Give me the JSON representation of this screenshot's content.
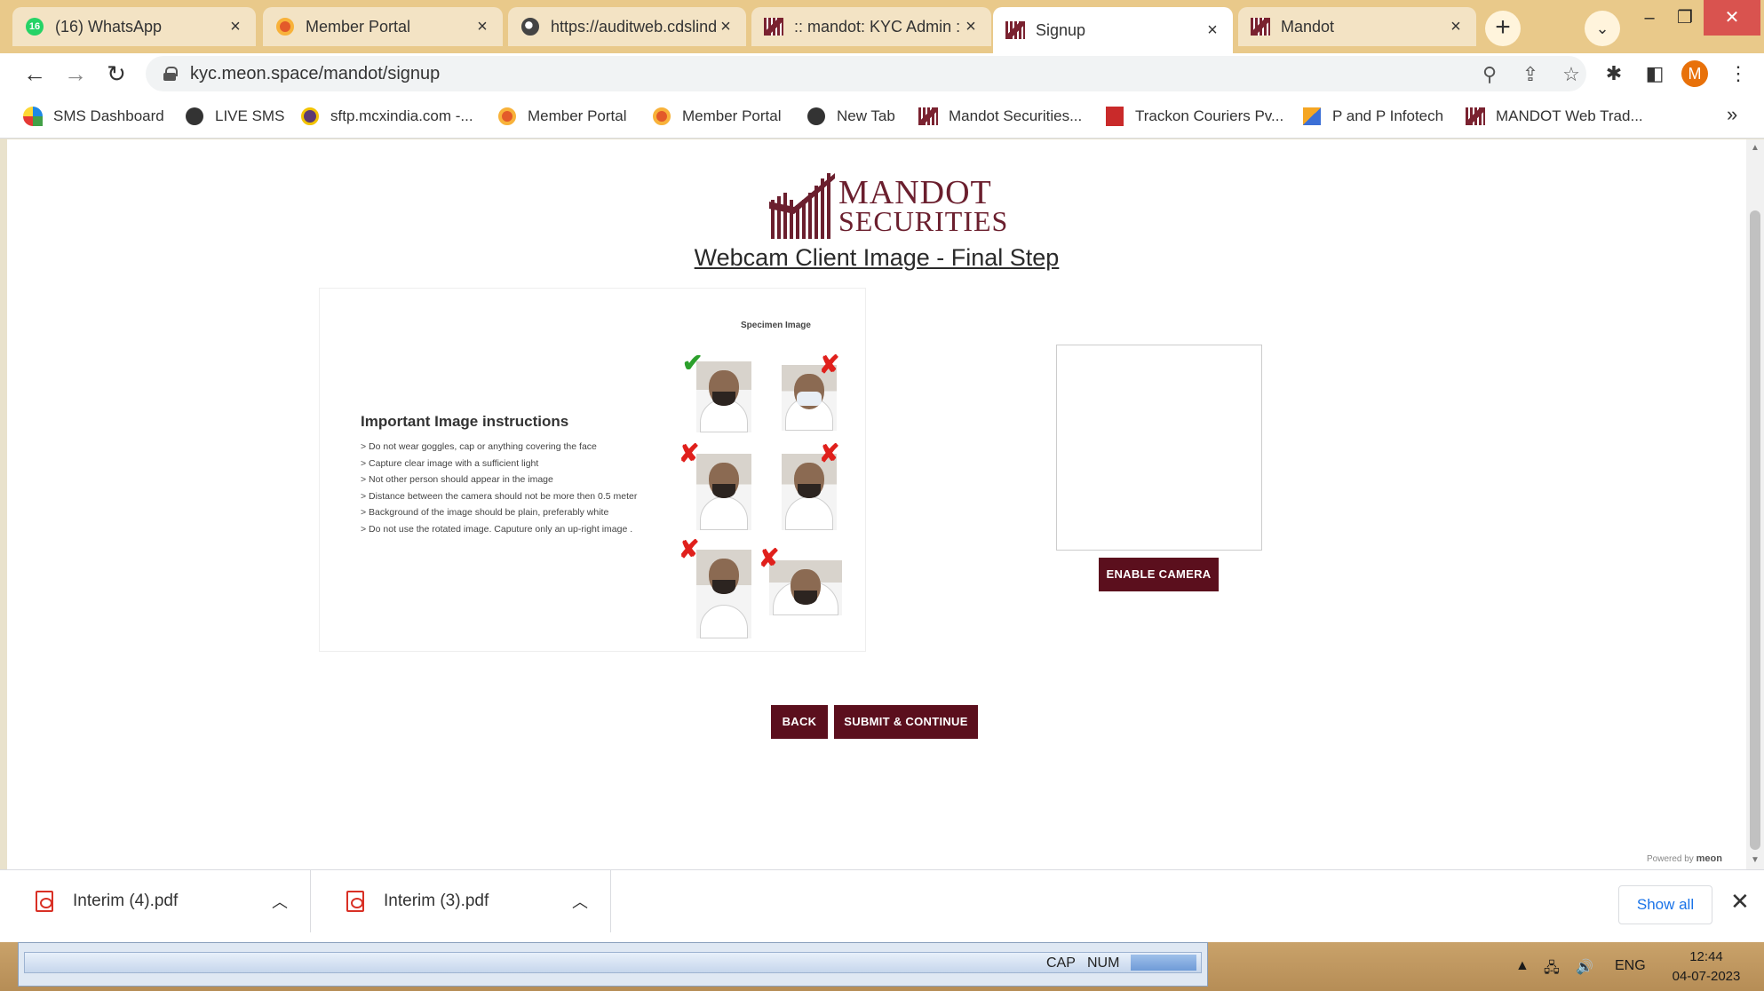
{
  "browser": {
    "tabs": [
      {
        "title": "(16) WhatsApp",
        "badge": "16",
        "icon": "whatsapp-icon",
        "active": false
      },
      {
        "title": "Member Portal",
        "icon": "member-portal-icon",
        "active": false
      },
      {
        "title": "https://auditweb.cdslindia.com",
        "icon": "globe-icon",
        "active": false
      },
      {
        "title": ":: mandot: KYC Admin ::",
        "icon": "mandot-logo-icon",
        "active": false
      },
      {
        "title": "Signup",
        "icon": "mandot-logo-icon",
        "active": true
      },
      {
        "title": "Mandot",
        "icon": "mandot-logo-icon",
        "active": false
      }
    ],
    "new_tab_label": "+",
    "url": "kyc.meon.space/mandot/signup",
    "profile_initial": "M",
    "bookmarks": [
      {
        "label": "SMS Dashboard",
        "icon": "sms-dashboard-icon"
      },
      {
        "label": "LIVE SMS",
        "icon": "globe-icon"
      },
      {
        "label": "sftp.mcxindia.com -...",
        "icon": "mcx-icon"
      },
      {
        "label": "Member Portal",
        "icon": "member-portal-icon"
      },
      {
        "label": "Member Portal",
        "icon": "member-portal-icon"
      },
      {
        "label": "New Tab",
        "icon": "globe-icon"
      },
      {
        "label": "Mandot Securities...",
        "icon": "mandot-logo-icon"
      },
      {
        "label": "Trackon Couriers Pv...",
        "icon": "trackon-icon"
      },
      {
        "label": "P and P Infotech",
        "icon": "pencil-icon"
      },
      {
        "label": "MANDOT Web Trad...",
        "icon": "mandot-logo-icon"
      }
    ],
    "bookmarks_overflow": "»"
  },
  "page": {
    "brand_name": "MANDOT",
    "brand_sub": "SECURITIES",
    "title": "Webcam Client Image - Final Step",
    "instructions": {
      "heading": "Important Image instructions",
      "items": [
        "> Do not wear goggles, cap or anything covering the face",
        "> Capture clear image with a sufficient light",
        ">  Not other person  should appear in the image",
        "> Distance between the camera should not be more then  0.5 meter",
        "> Background of the image should be plain, preferably white",
        "> Do not use the rotated image. Caputure only an up-right image ."
      ],
      "specimen_label": "Specimen Image",
      "specimens": [
        {
          "desc": "correct",
          "mark": "✔"
        },
        {
          "desc": "mask",
          "mark": "✘"
        },
        {
          "desc": "tilted",
          "mark": "✘"
        },
        {
          "desc": "distant",
          "mark": "✘"
        },
        {
          "desc": "other-person",
          "mark": "✘"
        },
        {
          "desc": "rotated",
          "mark": "✘"
        }
      ]
    },
    "enable_camera_label": "ENABLE CAMERA",
    "back_label": "BACK",
    "submit_label": "SUBMIT & CONTINUE",
    "powered_by": "Powered by",
    "powered_brand": "meon",
    "accent_color": "#5b0f1d"
  },
  "downloads": {
    "items": [
      {
        "name": "Interim (4).pdf"
      },
      {
        "name": "Interim (3).pdf"
      }
    ],
    "show_all_label": "Show all"
  },
  "taskbar": {
    "status_cap": "CAP",
    "status_num": "NUM",
    "language": "ENG",
    "time": "12:44",
    "date": "04-07-2023"
  }
}
